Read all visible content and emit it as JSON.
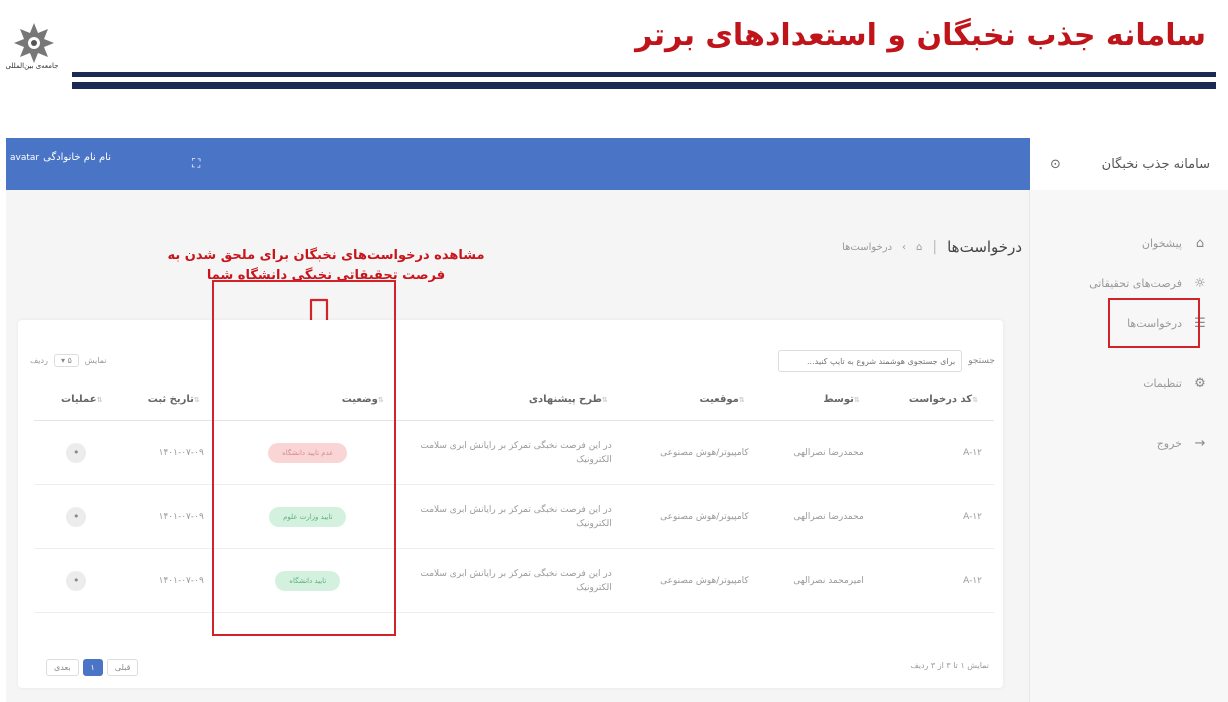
{
  "banner": {
    "title": "سامانه جذب نخبگان و استعدادهای برتر",
    "logo_caption": "جامعه‌ی بین‌المللی"
  },
  "sidebar": {
    "title": "سامانه جذب نخبگان",
    "items": [
      {
        "label": "پیشخوان",
        "icon": "home-icon"
      },
      {
        "label": "فرصت‌های تحقیقاتی",
        "icon": "lightbulb-icon"
      },
      {
        "label": "درخواست‌ها",
        "icon": "list-icon"
      },
      {
        "label": "تنظیمات",
        "icon": "settings-icon"
      },
      {
        "label": "خروج",
        "icon": "logout-icon"
      }
    ]
  },
  "topbar": {
    "user_name": "نام نام خانوادگی",
    "avatar_text": "avatar"
  },
  "page": {
    "title": "درخواست‌ها",
    "breadcrumb": "درخواست‌ها"
  },
  "annotation": {
    "line1": "مشاهده درخواست‌های نخبگان برای ملحق شدن به",
    "line2": "فرصت تحقیقاتی نخبگی دانشگاه شما"
  },
  "table": {
    "search_label": "جستجو",
    "search_placeholder": "برای جستجوی هوشمند شروع به تایپ کنید...",
    "show_label": "نمایش",
    "show_value": "۵",
    "show_suffix": "ردیف",
    "headers": [
      "کد درخواست",
      "توسط",
      "موقعیت",
      "طرح پیشنهادی",
      "وضعیت",
      "تاریخ ثبت",
      "عملیات"
    ],
    "rows": [
      {
        "code": "A-۱۲",
        "by": "محمدرضا نصرالهی",
        "position": "کامپیوتر/هوش مصنوعی",
        "plan": "در این فرصت نخبگی تمرکز بر رایانش ابری سلامت الکترونیک",
        "status": "عدم تایید دانشگاه",
        "status_color": "red",
        "date": "۱۴۰۱-۰۷-۰۹"
      },
      {
        "code": "A-۱۲",
        "by": "محمدرضا نصرالهی",
        "position": "کامپیوتر/هوش مصنوعی",
        "plan": "در این فرصت نخبگی تمرکز بر رایانش ابری سلامت الکترونیک",
        "status": "تایید وزارت علوم",
        "status_color": "green",
        "date": "۱۴۰۱-۰۷-۰۹"
      },
      {
        "code": "A-۱۲",
        "by": "امیرمحمد نصرالهی",
        "position": "کامپیوتر/هوش مصنوعی",
        "plan": "در این فرصت نخبگی تمرکز بر رایانش ابری سلامت الکترونیک",
        "status": "تایید دانشگاه",
        "status_color": "green",
        "date": "۱۴۰۱-۰۷-۰۹"
      }
    ],
    "footer_info": "نمایش ۱ تا ۳ از ۳ ردیف",
    "pager": {
      "prev": "قبلی",
      "current": "۱",
      "next": "بعدی"
    }
  },
  "colors": {
    "brand_blue": "#4a74c6",
    "highlight_red": "#d2232a",
    "title_red": "#c0141b"
  }
}
